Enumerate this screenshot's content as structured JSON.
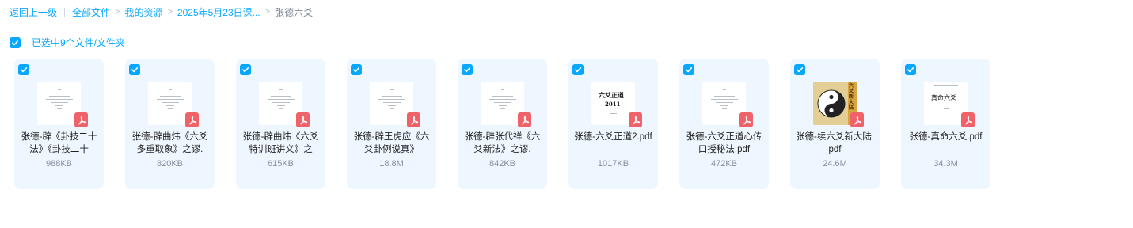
{
  "breadcrumb": {
    "back": "返回上一级",
    "items": [
      "全部文件",
      "我的资源",
      "2025年5月23日课..."
    ],
    "current": "张德六爻"
  },
  "selection": {
    "text": "已选中9个文件/文件夹"
  },
  "colors": {
    "accent": "#06a7ff",
    "card_bg": "#eef7ff",
    "pdf_badge": "#f0626a"
  },
  "files": [
    {
      "name": "张德-辟《卦技二十法》《卦技二十",
      "size": "988KB",
      "thumb": "text-doc",
      "icon": "pdf-icon"
    },
    {
      "name": "张德-辟曲炜《六爻多重取象》之谬.",
      "size": "820KB",
      "thumb": "text-doc",
      "icon": "pdf-icon"
    },
    {
      "name": "张德-辟曲炜《六爻特训班讲义》之",
      "size": "615KB",
      "thumb": "text-doc",
      "icon": "pdf-icon"
    },
    {
      "name": "张德-辟王虎应《六爻卦例说真》",
      "size": "18.8M",
      "thumb": "text-doc",
      "icon": "pdf-icon"
    },
    {
      "name": "张德-辟张代祥《六爻新法》之谬.",
      "size": "842KB",
      "thumb": "text-doc",
      "icon": "pdf-icon"
    },
    {
      "name": "张德-六爻正道2.pdf",
      "size": "1017KB",
      "thumb": "title-page",
      "thumb_title": "六爻正道",
      "thumb_sub": "2011",
      "icon": "pdf-icon"
    },
    {
      "name": "张德-六爻正道心传口授秘法.pdf",
      "size": "472KB",
      "thumb": "text-doc",
      "icon": "pdf-icon"
    },
    {
      "name": "张德-续六爻新大陆.pdf",
      "size": "24.6M",
      "thumb": "taiji-cover",
      "thumb_title": "六爻新大陆",
      "icon": "pdf-icon"
    },
    {
      "name": "张德-真命六爻.pdf",
      "size": "34.3M",
      "thumb": "title-page",
      "thumb_title": "真命六爻",
      "icon": "pdf-icon"
    }
  ]
}
